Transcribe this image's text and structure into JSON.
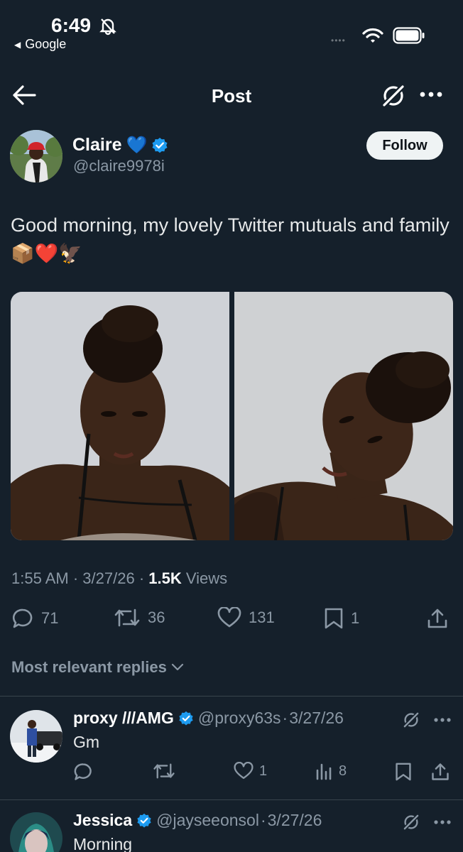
{
  "status_bar": {
    "time": "6:49",
    "back_app": "Google",
    "signal": "••••"
  },
  "header": {
    "title": "Post"
  },
  "author": {
    "name": "Claire",
    "emoji": "💙",
    "handle": "@claire9978i",
    "follow_label": "Follow"
  },
  "tweet": {
    "text": "Good morning, my lovely Twitter mutuals and family 📦❤️🦅",
    "time": "1:55 AM",
    "date": "3/27/26",
    "views_count": "1.5K",
    "views_label": "Views"
  },
  "actions": {
    "replies": "71",
    "reposts": "36",
    "likes": "131",
    "bookmarks": "1"
  },
  "replies_sort": {
    "label": "Most relevant replies"
  },
  "replies": [
    {
      "name": "proxy ///AMG",
      "handle": "@proxy63s",
      "date": "3/27/26",
      "text": "Gm",
      "likes": "1",
      "views": "8"
    },
    {
      "name": "Jessica",
      "handle": "@jayseeonsol",
      "date": "3/27/26",
      "text": "Morning"
    }
  ],
  "colors": {
    "background": "#15202b",
    "verified": "#1d9bf0",
    "muted": "#8b98a5"
  }
}
